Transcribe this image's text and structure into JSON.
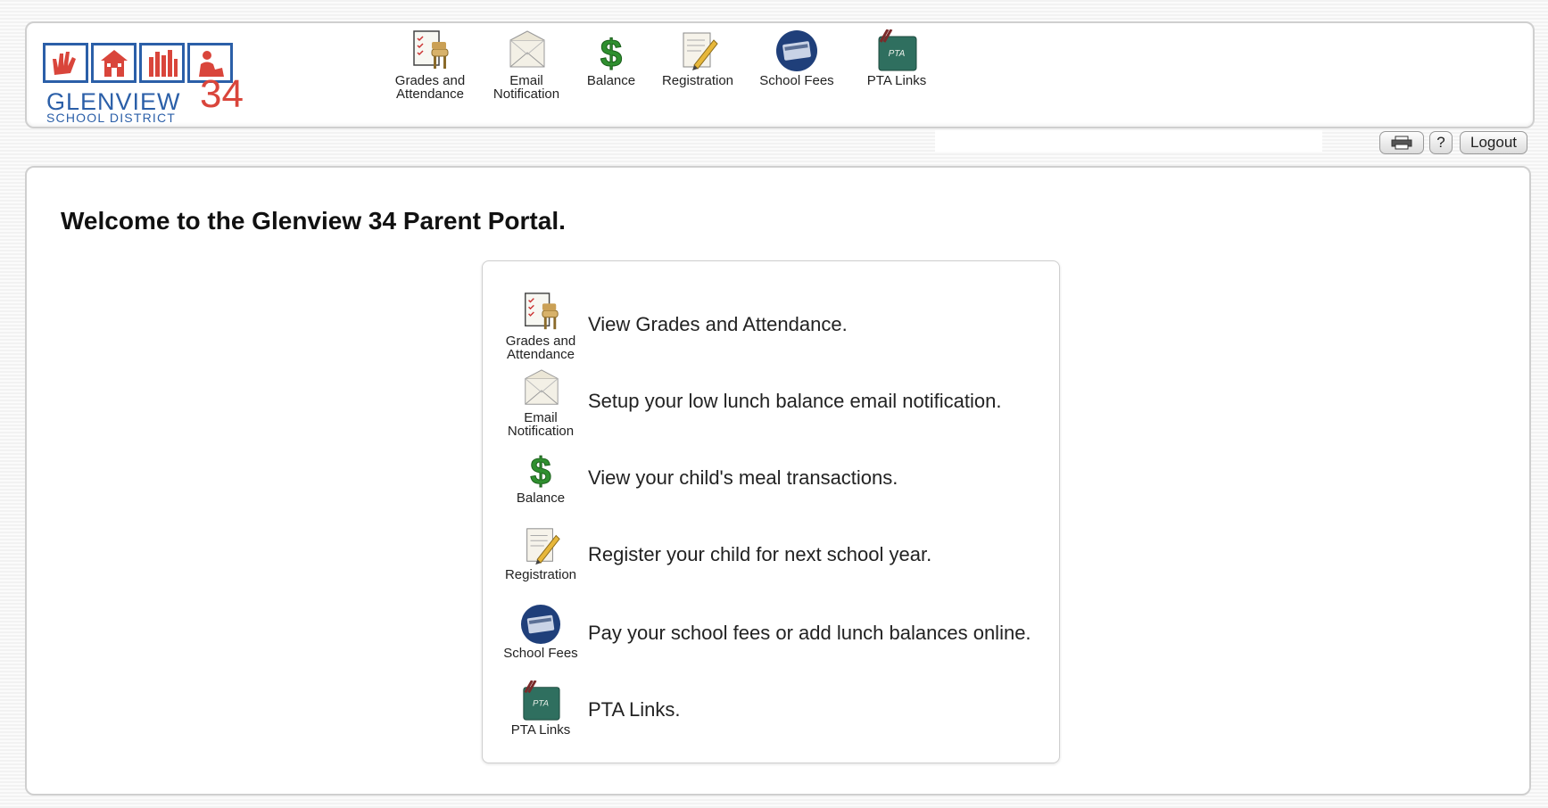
{
  "logo": {
    "district_name": "GLENVIEW",
    "district_number": "34",
    "district_sub": "SCHOOL DISTRICT"
  },
  "nav": [
    {
      "label_line1": "Grades and",
      "label_line2": "Attendance",
      "icon": "grades-attendance-icon"
    },
    {
      "label_line1": "Email",
      "label_line2": "Notification",
      "icon": "email-envelope-icon"
    },
    {
      "label_line1": "Balance",
      "label_line2": "",
      "icon": "dollar-icon"
    },
    {
      "label_line1": "Registration",
      "label_line2": "",
      "icon": "registration-scroll-icon"
    },
    {
      "label_line1": "School Fees",
      "label_line2": "",
      "icon": "school-fees-icon"
    },
    {
      "label_line1": "PTA Links",
      "label_line2": "",
      "icon": "pta-chalkboard-icon"
    }
  ],
  "toolbar": {
    "print_icon": "print-icon",
    "help_label": "?",
    "logout_label": "Logout"
  },
  "welcome": "Welcome to the Glenview 34 Parent Portal.",
  "items": [
    {
      "icon_line1": "Grades and",
      "icon_line2": "Attendance",
      "description": "View Grades and Attendance."
    },
    {
      "icon_line1": "Email",
      "icon_line2": "Notification",
      "description": "Setup your low lunch balance email notification."
    },
    {
      "icon_line1": "Balance",
      "icon_line2": "",
      "description": "View your child's meal transactions."
    },
    {
      "icon_line1": "Registration",
      "icon_line2": "",
      "description": "Register your child for next school year."
    },
    {
      "icon_line1": "School Fees",
      "icon_line2": "",
      "description": "Pay your school fees or add lunch balances online."
    },
    {
      "icon_line1": "PTA Links",
      "icon_line2": "",
      "description": "PTA Links."
    }
  ],
  "colors": {
    "logo_blue": "#2b5fa8",
    "logo_red": "#d9453b",
    "dollar_green": "#2f8f2f",
    "fees_blue": "#1f3f7a",
    "pta_green": "#2f6f5f"
  }
}
